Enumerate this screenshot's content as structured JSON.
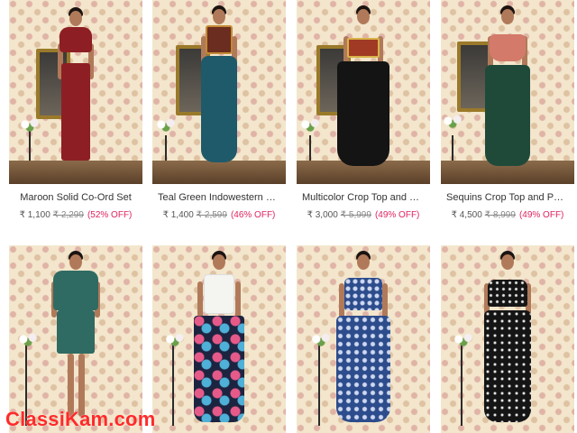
{
  "products": [
    {
      "title": "Maroon Solid Co-Ord Set",
      "price": "₹ 1,100",
      "mrp": "₹ 2,299",
      "discount": "(52% OFF)"
    },
    {
      "title": "Teal Green Indowestern Co...",
      "price": "₹ 1,400",
      "mrp": "₹ 2,599",
      "discount": "(46% OFF)"
    },
    {
      "title": "Multicolor Crop Top and Pa...",
      "price": "₹ 3,000",
      "mrp": "₹ 5,999",
      "discount": "(49% OFF)"
    },
    {
      "title": "Sequins Crop Top and Pala...",
      "price": "₹ 4,500",
      "mrp": "₹ 8,999",
      "discount": "(49% OFF)"
    }
  ],
  "outfit_colors": {
    "p1_top": "#8d1f24",
    "p1_bottom": "#8d1f24",
    "p2_top": "#6b2d1f",
    "p2_bottom": "#1f5a6b",
    "p3_top": "#a03a24",
    "p3_bottom": "#141414",
    "p4_top": "#d47a6a",
    "p4_bottom": "#1f4a3a",
    "p5_top": "#2f6b63",
    "p5_bottom": "#2f6b63",
    "p6_top": "#f4f4f0",
    "p6_bottom": "#1c2440",
    "p7_top": "#2c4c8c",
    "p7_bottom": "#2c4c8c",
    "p8_top": "#151515",
    "p8_bottom": "#151515"
  },
  "watermark": "ClassiKam.com"
}
